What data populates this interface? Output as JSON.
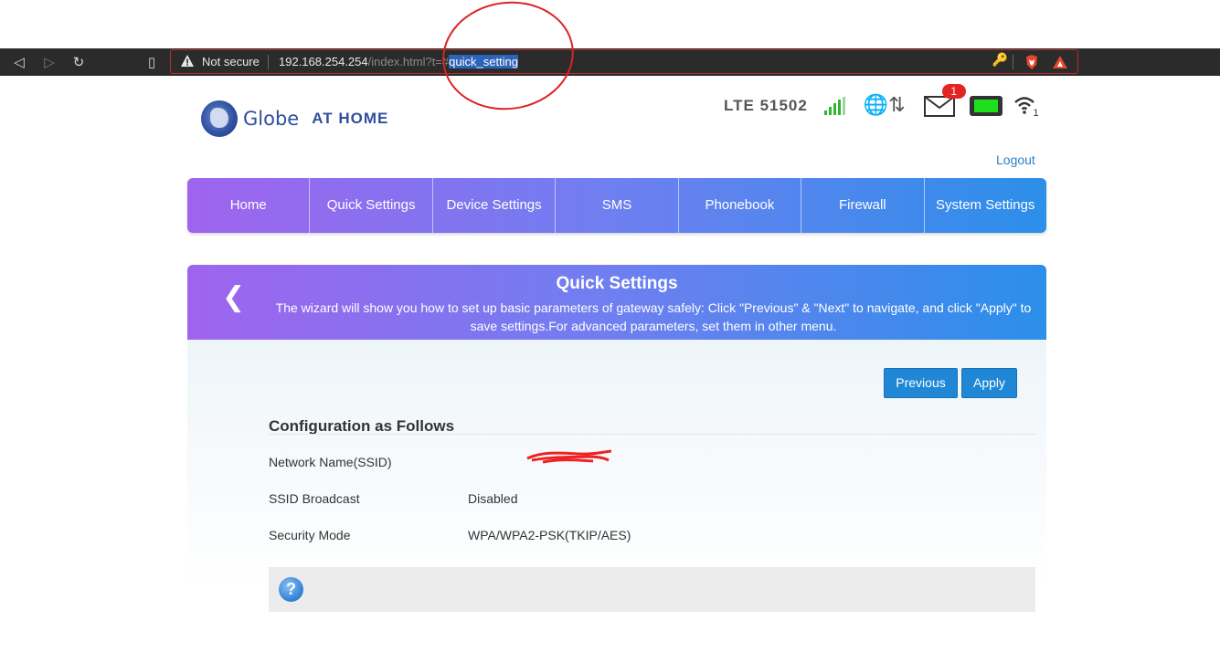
{
  "browser": {
    "security_label": "Not secure",
    "url_host": "192.168.254.254",
    "url_path": "/index.html?t=#",
    "url_fragment": "quick_setting"
  },
  "header": {
    "brand_name": "Globe",
    "brand_suffix": "AT HOME",
    "network": "LTE  51502",
    "unread_messages": "1",
    "wifi_clients": "1",
    "logout_label": "Logout"
  },
  "menu": {
    "items": [
      "Home",
      "Quick Settings",
      "Device Settings",
      "SMS",
      "Phonebook",
      "Firewall",
      "System Settings"
    ]
  },
  "panel": {
    "title": "Quick Settings",
    "description": "The wizard will show you how to set up basic parameters of gateway safely: Click \"Previous\" & \"Next\" to navigate, and click \"Apply\" to save settings.For advanced parameters, set them in other menu.",
    "previous_label": "Previous",
    "apply_label": "Apply",
    "config_title": "Configuration as Follows",
    "rows": [
      {
        "label": "Network Name(SSID)",
        "value": ""
      },
      {
        "label": "SSID Broadcast",
        "value": "Disabled"
      },
      {
        "label": "Security Mode",
        "value": "WPA/WPA2-PSK(TKIP/AES)"
      }
    ],
    "help_icon_text": "?"
  },
  "colors": {
    "accent_blue": "#1f87d6",
    "gradient_start": "#9f64ee",
    "gradient_end": "#2b8fea",
    "signal_green": "#2fb82f",
    "battery_green": "#1de01d",
    "badge_red": "#e62323",
    "annotation_red": "#d22222"
  }
}
